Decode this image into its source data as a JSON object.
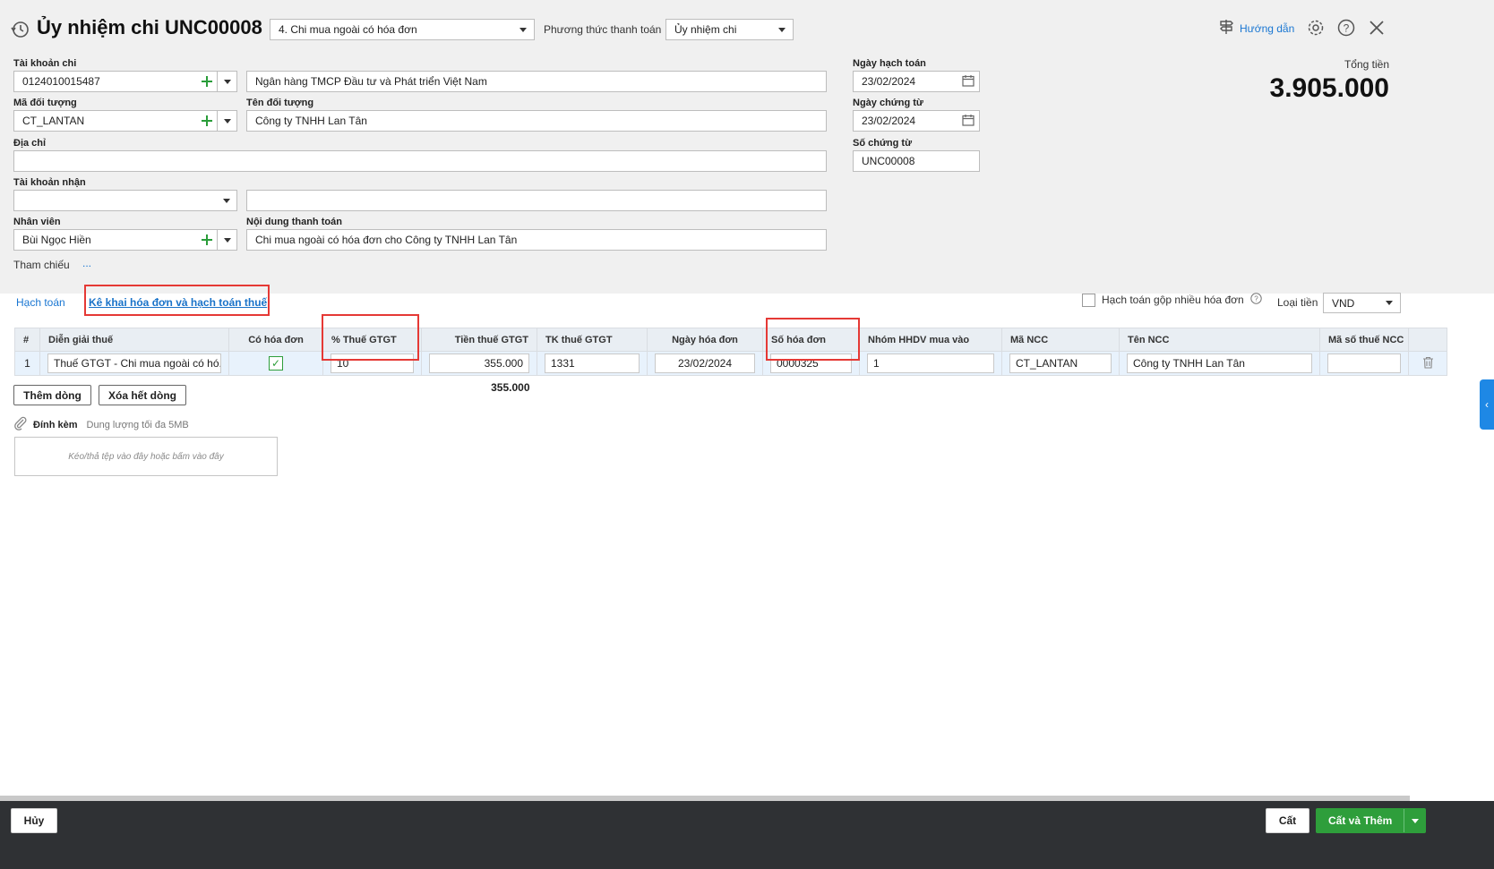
{
  "header": {
    "title": "Ủy nhiệm chi UNC00008",
    "type_select": "4. Chi mua ngoài có hóa đơn",
    "payment_method_label": "Phương thức thanh toán",
    "payment_method_value": "Ủy nhiệm chi",
    "guide_label": "Hướng dẫn"
  },
  "form": {
    "account_label": "Tài khoản chi",
    "account_value": "0124010015487",
    "bank_value": "Ngân hàng TMCP Đầu tư và Phát triển Việt Nam",
    "object_code_label": "Mã đối tượng",
    "object_code_value": "CT_LANTAN",
    "object_name_label": "Tên đối tượng",
    "object_name_value": "Công ty TNHH Lan Tân",
    "address_label": "Địa chỉ",
    "address_value": "",
    "receive_account_label": "Tài khoản nhận",
    "receive_account_value": "",
    "receive_bank_value": "",
    "employee_label": "Nhân viên",
    "employee_value": "Bùi Ngọc Hiền",
    "content_label": "Nội dung thanh toán",
    "content_value": "Chi mua ngoài có hóa đơn cho  Công ty TNHH Lan Tân",
    "reference_label": "Tham chiếu",
    "reference_value": "...",
    "posting_date_label": "Ngày hạch toán",
    "posting_date_value": "23/02/2024",
    "voucher_date_label": "Ngày chứng từ",
    "voucher_date_value": "23/02/2024",
    "voucher_no_label": "Số chứng từ",
    "voucher_no_value": "UNC00008",
    "total_label": "Tổng tiền",
    "total_value": "3.905.000"
  },
  "tabs": {
    "accounting": "Hạch toán",
    "invoice_tax": "Kê khai hóa đơn và hạch toán thuế",
    "merge_label": "Hạch toán gộp nhiều hóa đơn",
    "currency_label": "Loại tiền",
    "currency_value": "VND"
  },
  "grid": {
    "headers": [
      "#",
      "Diễn giải thuế",
      "Có hóa đơn",
      "% Thuế GTGT",
      "Tiền thuế GTGT",
      "TK thuế GTGT",
      "Ngày hóa đơn",
      "Số hóa đơn",
      "Nhóm HHDV mua vào",
      "Mã NCC",
      "Tên NCC",
      "Mã số thuế NCC"
    ],
    "rows": [
      {
        "no": "1",
        "desc": "Thuế GTGT - Chi mua ngoài có hó...",
        "vat_rate": "10",
        "vat_amount": "355.000",
        "vat_account": "1331",
        "invoice_date": "23/02/2024",
        "invoice_no": "0000325",
        "goods_group": "1",
        "supplier_code": "CT_LANTAN",
        "supplier_name": "Công ty TNHH Lan Tân",
        "supplier_tax": ""
      }
    ],
    "total_vat": "355.000"
  },
  "actions": {
    "add_row": "Thêm dòng",
    "delete_rows": "Xóa hết dòng"
  },
  "attachment": {
    "label": "Đính kèm",
    "hint": "Dung lượng tối đa 5MB",
    "drop_text": "Kéo/thả tệp vào đây hoặc bấm vào đây"
  },
  "footer": {
    "cancel": "Hủy",
    "save": "Cất",
    "save_add": "Cất và Thêm"
  },
  "colors": {
    "accent": "#1976d2",
    "highlight": "#e53935",
    "green": "#2e9e3b",
    "footer_bg": "#2f3134"
  }
}
